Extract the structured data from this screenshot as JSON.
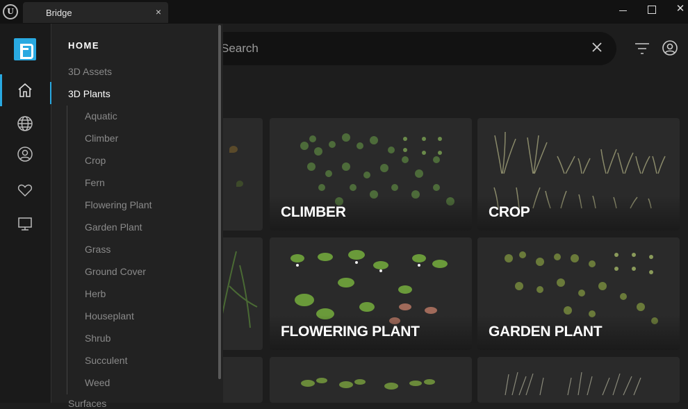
{
  "window": {
    "tab_title": "Bridge",
    "tab_close": "×",
    "minimize": "",
    "maximize": "",
    "close": "✕"
  },
  "rail": {
    "icons": [
      "home-icon",
      "globe-icon",
      "user-icon",
      "heart-icon",
      "monitor-icon"
    ]
  },
  "drawer": {
    "heading": "HOME",
    "items": [
      {
        "label": "3D Assets"
      },
      {
        "label": "3D Plants"
      }
    ],
    "sub_items": [
      "Aquatic",
      "Climber",
      "Crop",
      "Fern",
      "Flowering Plant",
      "Garden Plant",
      "Grass",
      "Ground Cover",
      "Herb",
      "Houseplant",
      "Shrub",
      "Succulent",
      "Weed"
    ],
    "cut_off_item": "Surfaces"
  },
  "search": {
    "placeholder": "Search"
  },
  "cards": [
    {
      "label": "CLIMBER"
    },
    {
      "label": "CROP"
    },
    {
      "label": "FLOWERING PLANT"
    },
    {
      "label": "GARDEN PLANT"
    }
  ],
  "colors": {
    "accent": "#29a9e1",
    "background": "#1d1d1d",
    "card": "#2a2a2a"
  }
}
